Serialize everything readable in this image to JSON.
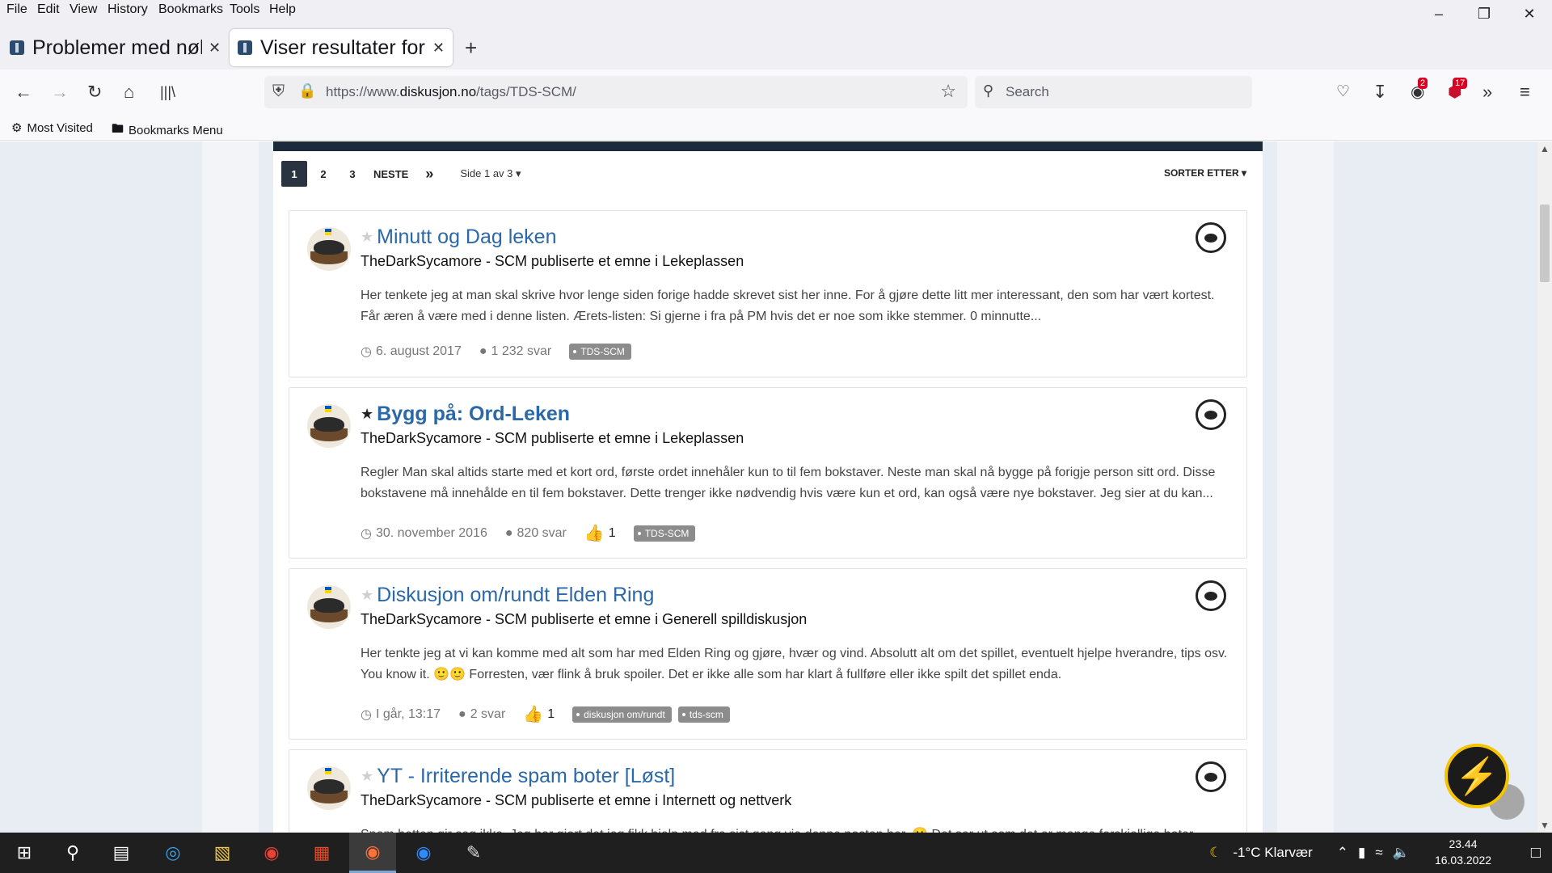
{
  "menu": [
    "File",
    "Edit",
    "View",
    "History",
    "Bookmarks",
    "Tools",
    "Help"
  ],
  "tabs": [
    {
      "title": "Problemer med nøkkelord/tags",
      "active": false
    },
    {
      "title": "Viser resultater for emneknagger",
      "active": true
    }
  ],
  "url": {
    "prefix": "https://www.",
    "domain": "diskusjon.no",
    "path": "/tags/TDS-SCM/"
  },
  "search": {
    "placeholder": "Search"
  },
  "toolbar_badges": {
    "extensions_count": "2",
    "ublock_count": "17"
  },
  "bookmarks": [
    "Most Visited",
    "Bookmarks Menu"
  ],
  "pagination": {
    "pages": [
      "1",
      "2",
      "3"
    ],
    "current": "1",
    "next_label": "NESTE",
    "last_label": "»",
    "page_info": "Side 1 av 3 ▾",
    "sort_label": "SORTER ETTER ▾"
  },
  "topics": [
    {
      "title": "Minutt og Dag leken",
      "starred": false,
      "byline": "TheDarkSycamore - SCM publiserte et emne i Lekeplassen",
      "snippet": "Her tenkete jeg at man skal skrive hvor lenge siden forige hadde skrevet sist her inne. For å gjøre dette litt mer interessant, den som har vært kortest. Får æren å være med i denne listen. Ærets-listen: Si gjerne i fra på PM hvis det er noe som ikke stemmer. 0 minnutte...",
      "date": "6. august 2017",
      "replies": "1 232 svar",
      "likes": "",
      "tags": [
        "TDS-SCM"
      ]
    },
    {
      "title": "Bygg på: Ord-Leken",
      "starred": true,
      "byline": "TheDarkSycamore - SCM publiserte et emne i Lekeplassen",
      "snippet": "Regler Man skal altids starte med et kort ord, første ordet innehåler kun to til fem bokstaver. Neste man skal nå bygge på forigje person sitt ord. Disse bokstavene må innehålde en til fem bokstaver. Dette trenger ikke nødvendig hvis være kun et ord, kan også være nye bokstaver. Jeg sier at du kan...",
      "date": "30. november 2016",
      "replies": "820 svar",
      "likes": "1",
      "tags": [
        "TDS-SCM"
      ]
    },
    {
      "title": "Diskusjon om/rundt Elden Ring",
      "starred": false,
      "byline": "TheDarkSycamore - SCM publiserte et emne i Generell spilldiskusjon",
      "snippet": "Her tenkte jeg at vi kan komme med alt som har med Elden Ring og gjøre, hvær og vind. Absolutt alt om det spillet, eventuelt hjelpe hverandre, tips osv. You know it. 🙂🙂 Forresten, vær flink å bruk spoiler. Det er ikke alle som har klart å fullføre eller ikke spilt det spillet enda.",
      "date": "I går, 13:17",
      "replies": "2 svar",
      "likes": "1",
      "tags": [
        "diskusjon om/rundt",
        "tds-scm"
      ]
    },
    {
      "title": "YT - Irriterende spam boter [Løst]",
      "starred": false,
      "byline": "TheDarkSycamore - SCM publiserte et emne i Internett og nettverk",
      "snippet": "Spam botten gir seg ikke. Jeg har gjort det jeg fikk hjelp med fra sist gang via denne posten her. 🙁 Det ser ut som det er mange forskjellige boter...",
      "date": "",
      "replies": "",
      "likes": "",
      "tags": []
    }
  ],
  "taskbar": {
    "weather": "-1°C  Klarvær",
    "time": "23.44",
    "date": "16.03.2022"
  },
  "colors": {
    "accent": "#2b68a8",
    "topbar": "#1c2b3c",
    "page_bg": "#e8edf3",
    "tag_bg": "#8c8c8c"
  }
}
